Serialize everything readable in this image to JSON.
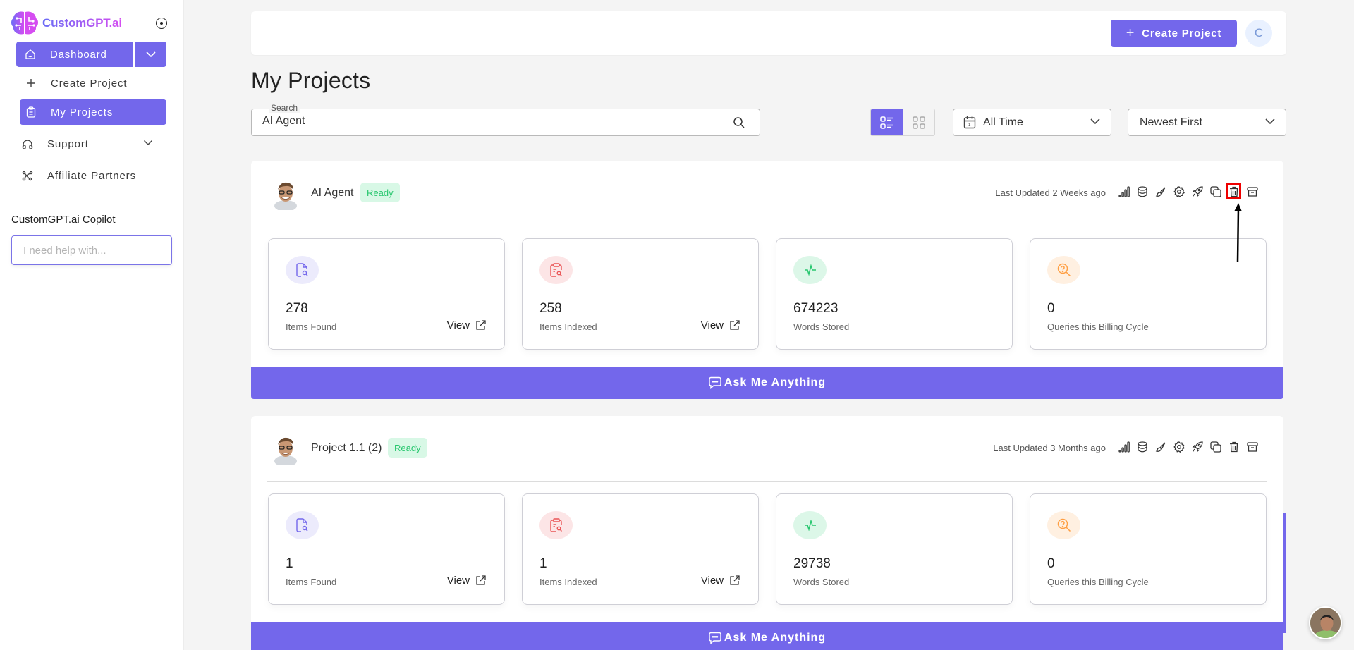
{
  "brand": {
    "name": "CustomGPT.ai",
    "accent": "#7367eb"
  },
  "sidebar": {
    "dashboard_label": "Dashboard",
    "items": [
      {
        "label": "Create Project",
        "icon": "plus-icon"
      },
      {
        "label": "My Projects",
        "icon": "clipboard-icon",
        "active": true
      },
      {
        "label": "Support",
        "icon": "headphones-icon"
      },
      {
        "label": "Affiliate Partners",
        "icon": "affiliate-icon"
      }
    ],
    "copilot": {
      "title": "CustomGPT.ai Copilot",
      "placeholder": "I need help with..."
    }
  },
  "header": {
    "create_label": "Create Project",
    "user_initial": "C"
  },
  "page": {
    "title": "My Projects"
  },
  "filters": {
    "search_legend": "Search",
    "search_value": "AI Agent",
    "view_mode": "list",
    "time_range": "All Time",
    "sort": "Newest First"
  },
  "projects": [
    {
      "name": "AI Agent",
      "status": "Ready",
      "updated": "Last Updated 2 Weeks ago",
      "stats": [
        {
          "value": "278",
          "label": "Items Found",
          "link": "View"
        },
        {
          "value": "258",
          "label": "Items Indexed",
          "link": "View"
        },
        {
          "value": "674223",
          "label": "Words Stored"
        },
        {
          "value": "0",
          "label": "Queries this Billing Cycle"
        }
      ],
      "ask_label": "Ask Me Anything"
    },
    {
      "name": "Project 1.1 (2)",
      "status": "Ready",
      "updated": "Last Updated 3 Months ago",
      "stats": [
        {
          "value": "1",
          "label": "Items Found",
          "link": "View"
        },
        {
          "value": "1",
          "label": "Items Indexed",
          "link": "View"
        },
        {
          "value": "29738",
          "label": "Words Stored"
        },
        {
          "value": "0",
          "label": "Queries this Billing Cycle"
        }
      ],
      "ask_label": "Ask Me Anything"
    }
  ],
  "project_actions": [
    "analytics",
    "data-sources",
    "personalize",
    "settings",
    "deploy",
    "duplicate",
    "delete",
    "archive"
  ],
  "colors": {
    "accent": "#7367eb",
    "ready_bg": "#d8f8e6",
    "ready_text": "#29c76f",
    "items_found": "#7367eb",
    "items_indexed": "#ea5455",
    "words_stored": "#28c76f",
    "queries": "#ff9f43"
  }
}
